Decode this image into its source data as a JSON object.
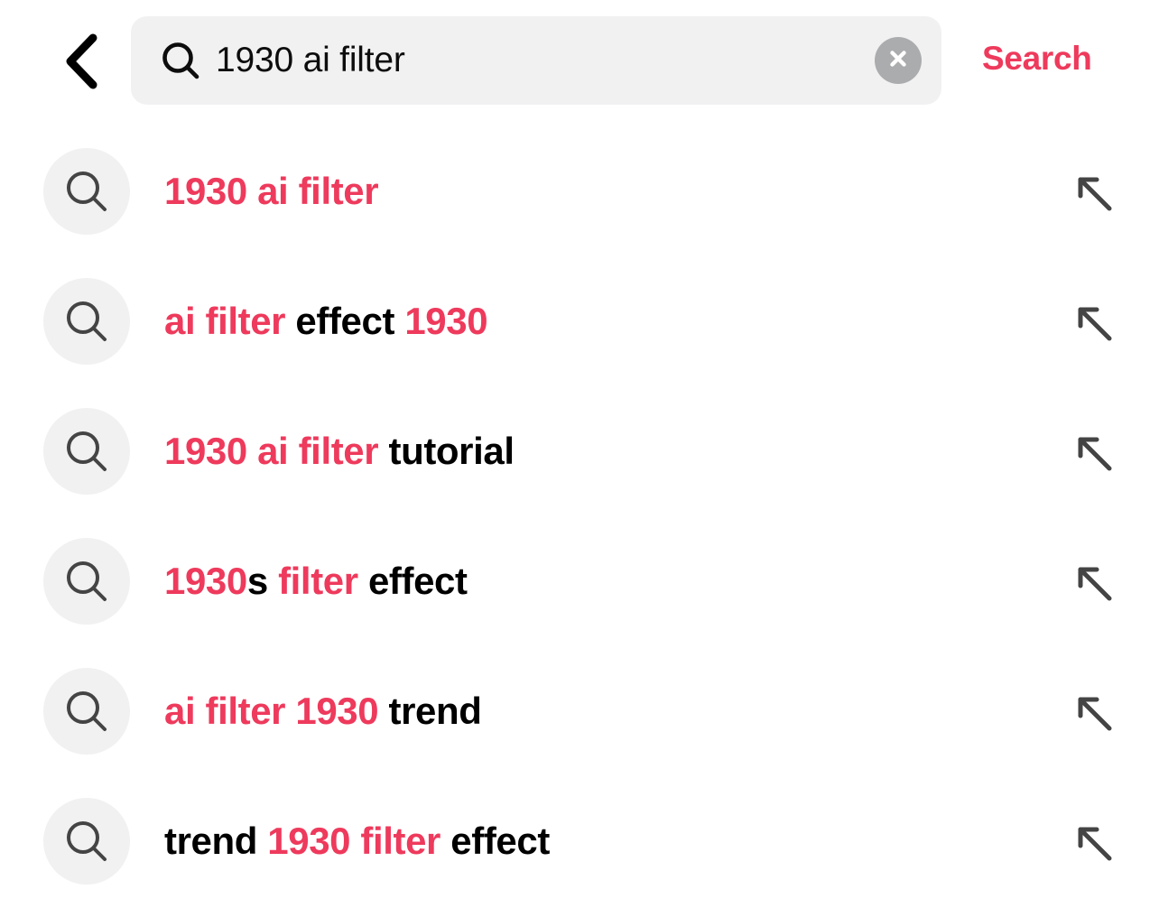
{
  "theme": {
    "accent": "#ee3a5c",
    "text_primary": "#000000",
    "field_bg": "#f1f1f2",
    "clear_bg": "#abacad",
    "icon_gray": "#444444",
    "page_bg": "#ffffff"
  },
  "header": {
    "back_label": "Back",
    "search_icon_name": "search-icon",
    "query": "1930 ai filter",
    "placeholder": "Search",
    "clear_label": "Clear",
    "search_button_label": "Search"
  },
  "suggestions": {
    "items": [
      {
        "text": "1930 ai filter",
        "parts": [
          {
            "t": "1930 ai filter",
            "h": true
          }
        ]
      },
      {
        "text": "ai filter effect 1930",
        "parts": [
          {
            "t": "ai filter",
            "h": true
          },
          {
            "t": " effect ",
            "h": false
          },
          {
            "t": "1930",
            "h": true
          }
        ]
      },
      {
        "text": "1930 ai filter tutorial",
        "parts": [
          {
            "t": "1930 ai filter",
            "h": true
          },
          {
            "t": " tutorial",
            "h": false
          }
        ]
      },
      {
        "text": "1930s filter effect",
        "parts": [
          {
            "t": "1930",
            "h": true
          },
          {
            "t": "s ",
            "h": false
          },
          {
            "t": "filter",
            "h": true
          },
          {
            "t": " effect",
            "h": false
          }
        ]
      },
      {
        "text": "ai filter 1930 trend",
        "parts": [
          {
            "t": "ai filter 1930",
            "h": true
          },
          {
            "t": " trend",
            "h": false
          }
        ]
      },
      {
        "text": "trend 1930 filter effect",
        "parts": [
          {
            "t": "trend ",
            "h": false
          },
          {
            "t": "1930 filter",
            "h": true
          },
          {
            "t": " effect",
            "h": false
          }
        ]
      }
    ],
    "row_icon_name": "search-icon",
    "row_arrow_name": "arrow-up-left-icon",
    "row_arrow_label": "Fill search box"
  }
}
